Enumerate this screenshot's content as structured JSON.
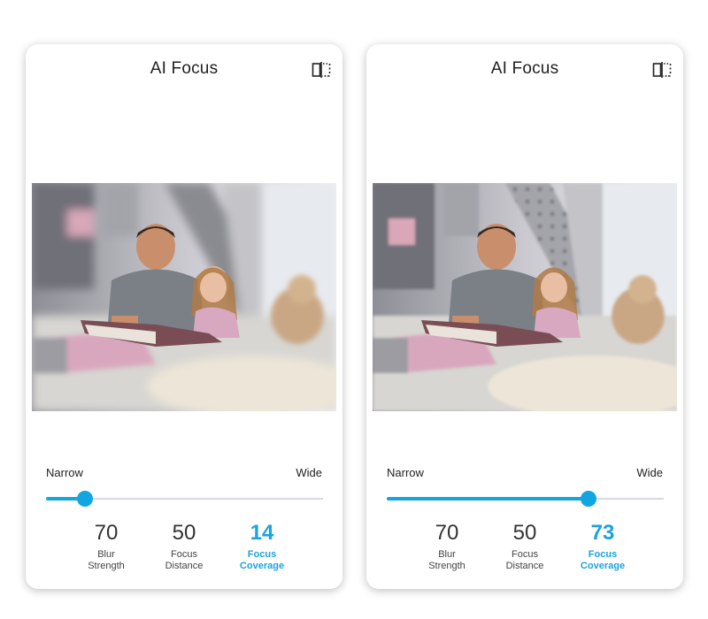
{
  "colors": {
    "accent": "#11a6e0",
    "track": "#d8d8ea"
  },
  "panels": [
    {
      "title": "AI Focus",
      "compare_icon": "compare-split-icon",
      "photo_focus": "background-blurred",
      "range": {
        "min_label": "Narrow",
        "max_label": "Wide"
      },
      "slider_value": 0.14,
      "metrics": [
        {
          "value": "70",
          "label_line1": "Blur",
          "label_line2": "Strength",
          "active": false
        },
        {
          "value": "50",
          "label_line1": "Focus",
          "label_line2": "Distance",
          "active": false
        },
        {
          "value": "14",
          "label_line1": "Focus",
          "label_line2": "Coverage",
          "active": true
        }
      ]
    },
    {
      "title": "AI Focus",
      "compare_icon": "compare-split-icon",
      "photo_focus": "mostly-sharp",
      "range": {
        "min_label": "Narrow",
        "max_label": "Wide"
      },
      "slider_value": 0.73,
      "metrics": [
        {
          "value": "70",
          "label_line1": "Blur",
          "label_line2": "Strength",
          "active": false
        },
        {
          "value": "50",
          "label_line1": "Focus",
          "label_line2": "Distance",
          "active": false
        },
        {
          "value": "73",
          "label_line1": "Focus",
          "label_line2": "Coverage",
          "active": true
        }
      ]
    }
  ]
}
